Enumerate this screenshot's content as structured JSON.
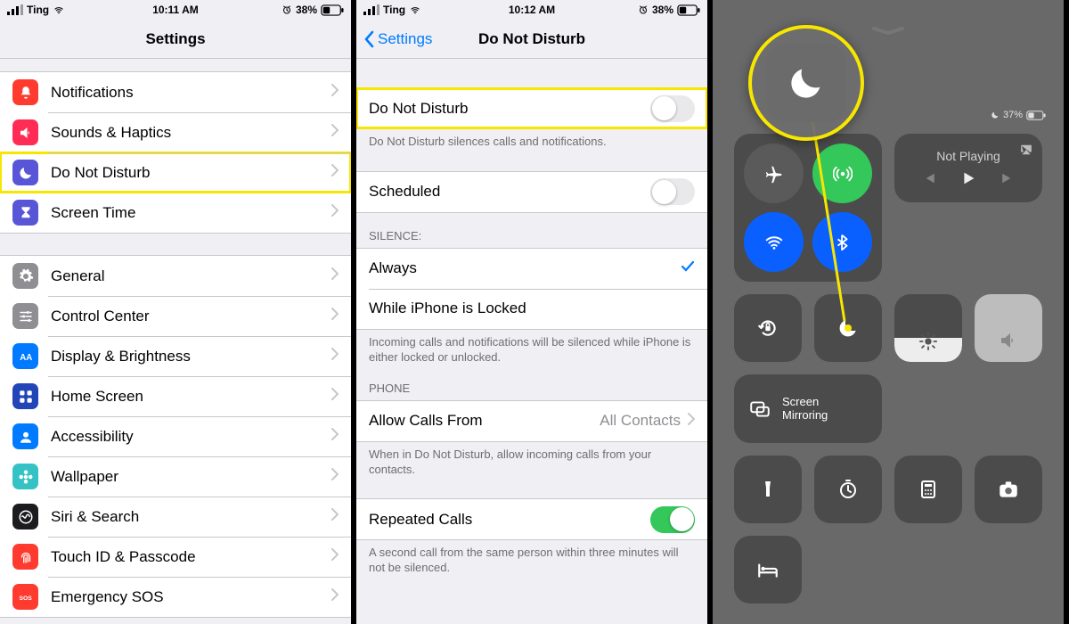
{
  "panel1": {
    "status": {
      "carrier": "Ting",
      "time": "10:11 AM",
      "battery": "38%"
    },
    "title": "Settings",
    "groups": [
      {
        "rows": [
          {
            "icon": "notifications",
            "color": "#ff3b30",
            "label": "Notifications"
          },
          {
            "icon": "sounds",
            "color": "#ff2d55",
            "label": "Sounds & Haptics"
          },
          {
            "icon": "dnd",
            "color": "#5856d6",
            "label": "Do Not Disturb",
            "highlight": true
          },
          {
            "icon": "screentime",
            "color": "#5856d6",
            "label": "Screen Time"
          }
        ]
      },
      {
        "rows": [
          {
            "icon": "general",
            "color": "#8e8e93",
            "label": "General"
          },
          {
            "icon": "controlcenter",
            "color": "#8e8e93",
            "label": "Control Center"
          },
          {
            "icon": "display",
            "color": "#007aff",
            "label": "Display & Brightness"
          },
          {
            "icon": "homescreen",
            "color": "#2245b7",
            "label": "Home Screen"
          },
          {
            "icon": "accessibility",
            "color": "#007aff",
            "label": "Accessibility"
          },
          {
            "icon": "wallpaper",
            "color": "#35c2c4",
            "label": "Wallpaper"
          },
          {
            "icon": "siri",
            "color": "#1c1c1e",
            "label": "Siri & Search"
          },
          {
            "icon": "touchid",
            "color": "#ff3b30",
            "label": "Touch ID & Passcode"
          },
          {
            "icon": "sos",
            "color": "#ff3b30",
            "label": "Emergency SOS"
          }
        ]
      }
    ]
  },
  "panel2": {
    "status": {
      "carrier": "Ting",
      "time": "10:12 AM",
      "battery": "38%"
    },
    "back": "Settings",
    "title": "Do Not Disturb",
    "sect1": {
      "dnd_label": "Do Not Disturb",
      "footer": "Do Not Disturb silences calls and notifications."
    },
    "sect2": {
      "scheduled": "Scheduled"
    },
    "sect3": {
      "header": "SILENCE:",
      "always": "Always",
      "locked": "While iPhone is Locked",
      "footer": "Incoming calls and notifications will be silenced while iPhone is either locked or unlocked."
    },
    "sect4": {
      "header": "PHONE",
      "allow": "Allow Calls From",
      "allow_detail": "All Contacts",
      "footer": "When in Do Not Disturb, allow incoming calls from your contacts."
    },
    "sect5": {
      "repeat": "Repeated Calls",
      "footer": "A second call from the same person within three minutes will not be silenced."
    }
  },
  "cc": {
    "battery": "37%",
    "media": "Not Playing",
    "mirror": "Screen Mirroring"
  }
}
